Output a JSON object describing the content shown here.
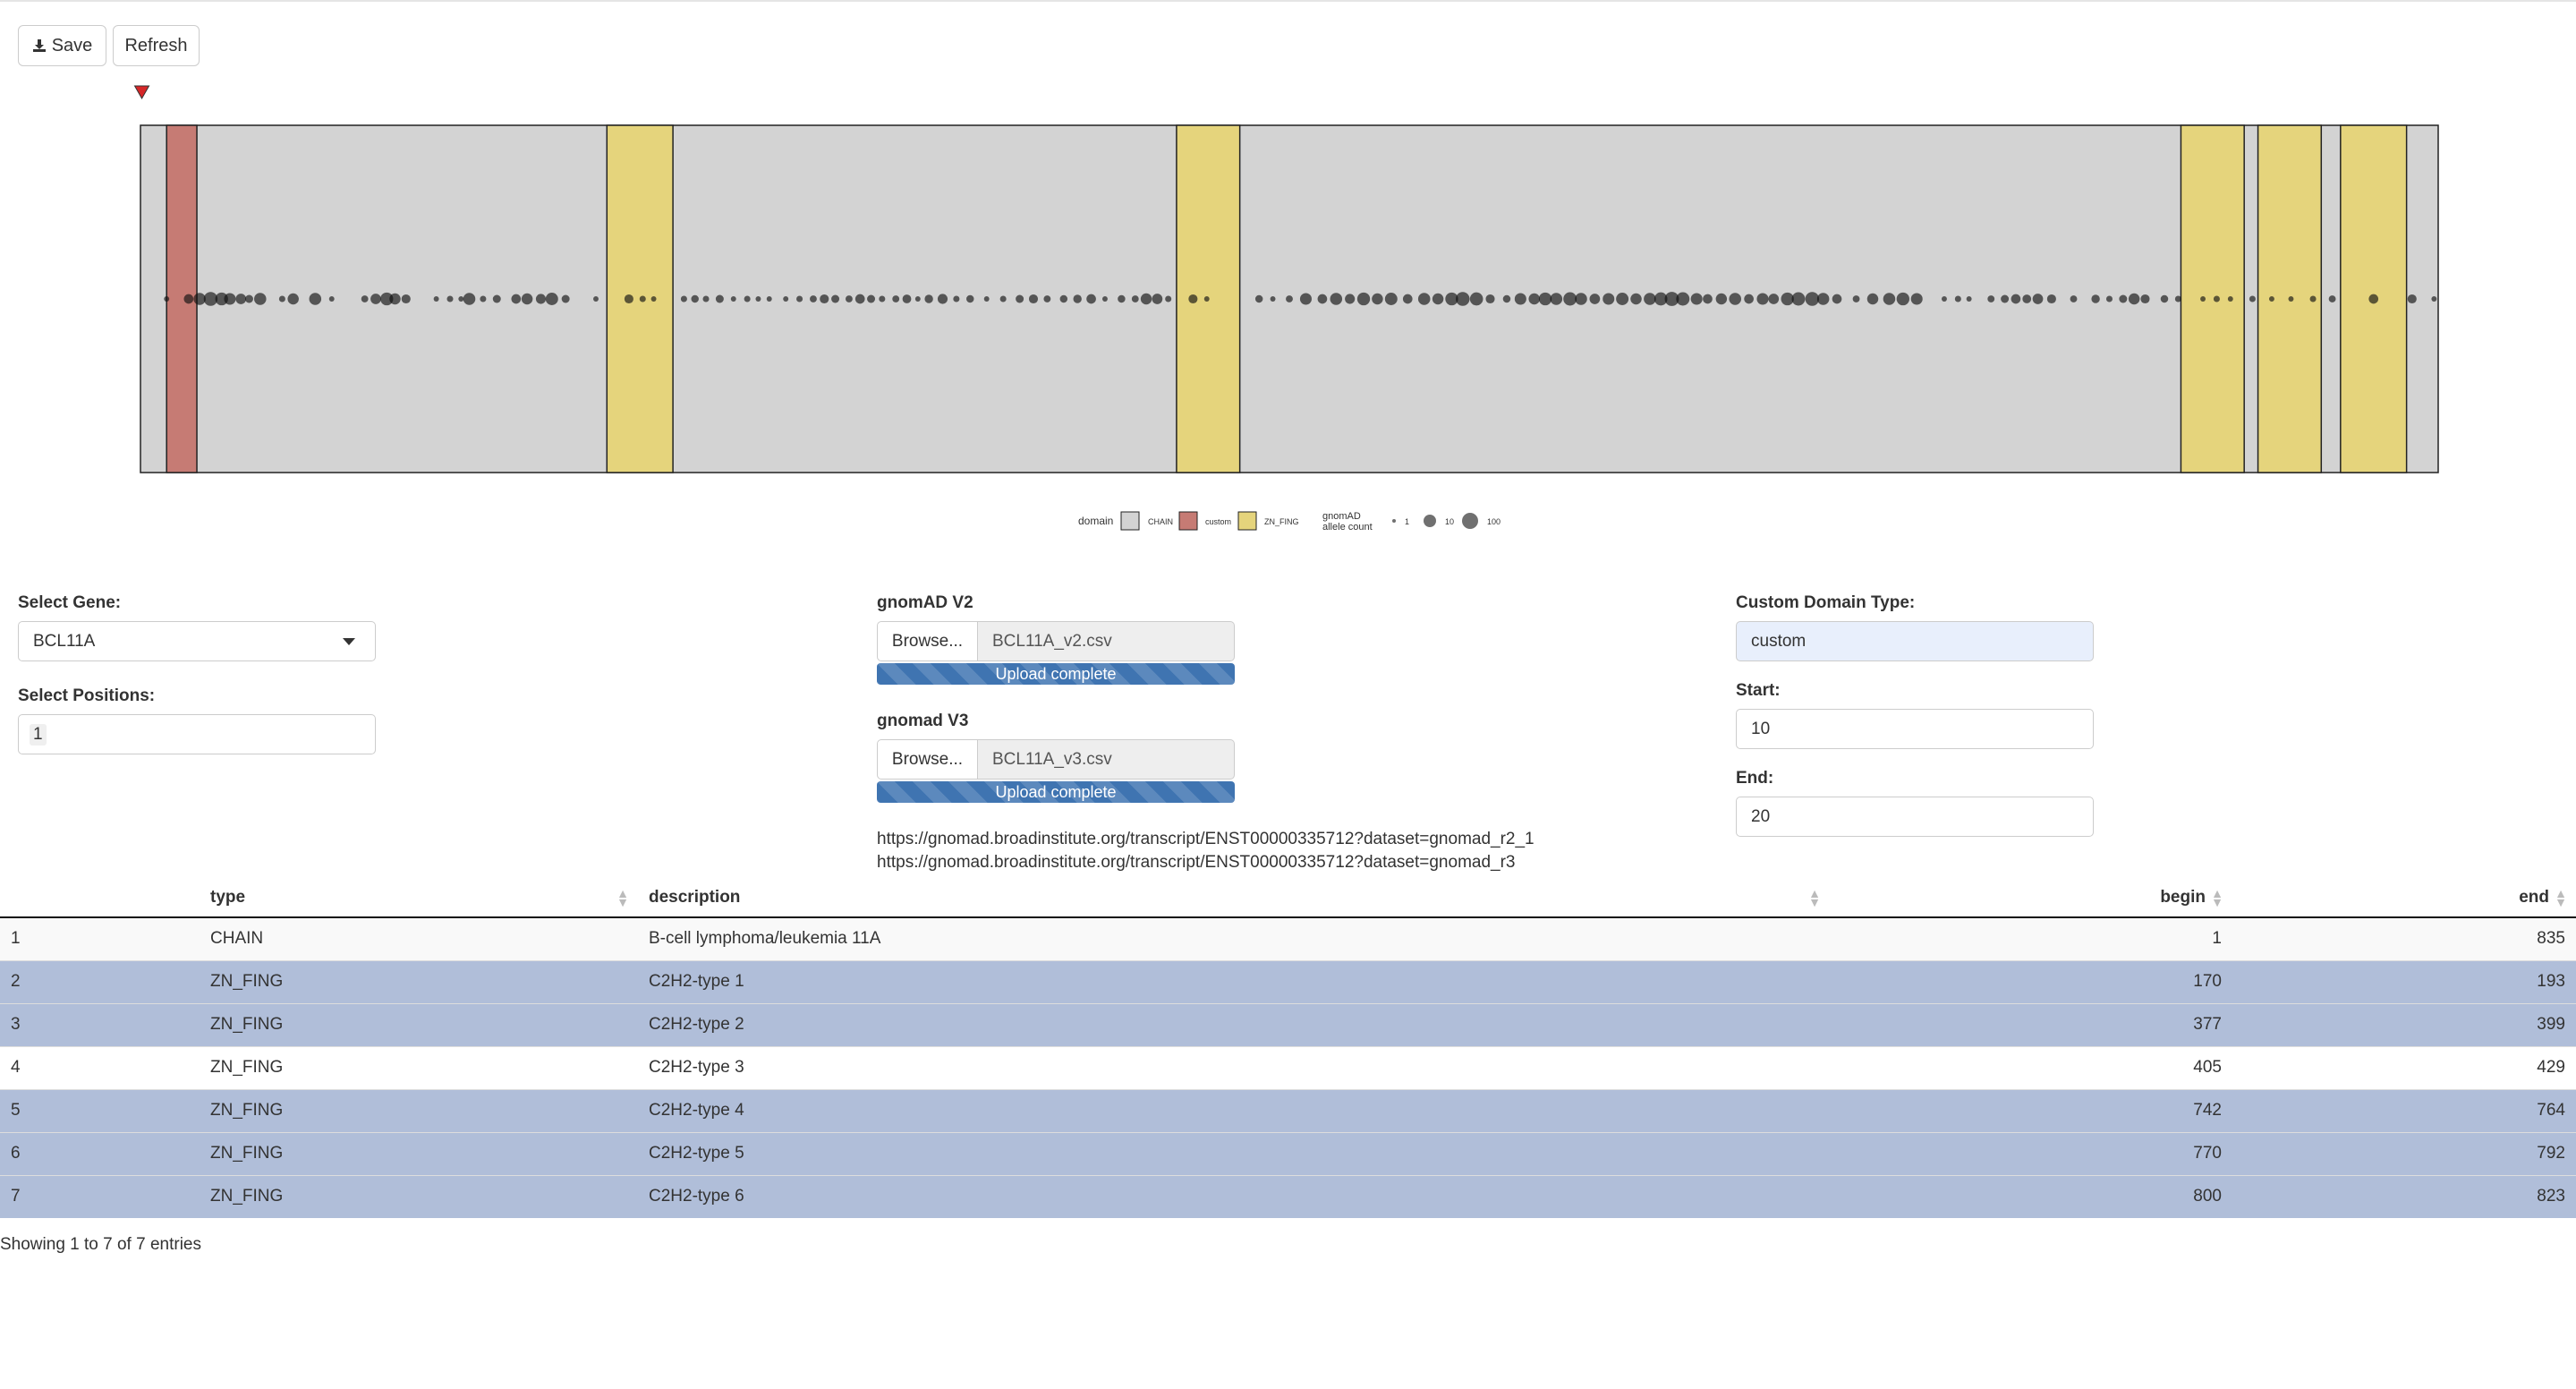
{
  "toolbar": {
    "save_label": "Save",
    "refresh_label": "Refresh"
  },
  "plot": {
    "protein_length": 835,
    "domains": [
      {
        "type": "CHAIN",
        "begin": 1,
        "end": 835,
        "color": "#d3d3d3"
      },
      {
        "type": "custom",
        "begin": 10,
        "end": 20,
        "color": "#c67b74"
      },
      {
        "type": "ZN_FING",
        "begin": 170,
        "end": 193,
        "color": "#e5d47c"
      },
      {
        "type": "ZN_FING",
        "begin": 377,
        "end": 399,
        "color": "#e5d47c"
      },
      {
        "type": "ZN_FING",
        "begin": 742,
        "end": 764,
        "color": "#e5d47c"
      },
      {
        "type": "ZN_FING",
        "begin": 770,
        "end": 792,
        "color": "#e5d47c"
      },
      {
        "type": "ZN_FING",
        "begin": 800,
        "end": 823,
        "color": "#e5d47c"
      }
    ],
    "selected_position": 1,
    "marker_color": "#d62728",
    "variant_allele_counts": [
      {
        "pos": 10,
        "count": 1
      },
      {
        "pos": 18,
        "count": 10
      },
      {
        "pos": 22,
        "count": 30
      },
      {
        "pos": 26,
        "count": 60
      },
      {
        "pos": 30,
        "count": 40
      },
      {
        "pos": 33,
        "count": 25
      },
      {
        "pos": 37,
        "count": 15
      },
      {
        "pos": 40,
        "count": 5
      },
      {
        "pos": 44,
        "count": 30
      },
      {
        "pos": 52,
        "count": 2
      },
      {
        "pos": 56,
        "count": 20
      },
      {
        "pos": 64,
        "count": 30
      },
      {
        "pos": 70,
        "count": 1
      },
      {
        "pos": 82,
        "count": 3
      },
      {
        "pos": 86,
        "count": 15
      },
      {
        "pos": 90,
        "count": 40
      },
      {
        "pos": 93,
        "count": 20
      },
      {
        "pos": 97,
        "count": 8
      },
      {
        "pos": 108,
        "count": 1
      },
      {
        "pos": 113,
        "count": 2
      },
      {
        "pos": 117,
        "count": 1
      },
      {
        "pos": 120,
        "count": 30
      },
      {
        "pos": 125,
        "count": 2
      },
      {
        "pos": 130,
        "count": 5
      },
      {
        "pos": 137,
        "count": 10
      },
      {
        "pos": 141,
        "count": 20
      },
      {
        "pos": 146,
        "count": 12
      },
      {
        "pos": 150,
        "count": 35
      },
      {
        "pos": 155,
        "count": 5
      },
      {
        "pos": 166,
        "count": 1
      },
      {
        "pos": 178,
        "count": 8
      },
      {
        "pos": 183,
        "count": 2
      },
      {
        "pos": 187,
        "count": 1
      },
      {
        "pos": 198,
        "count": 2
      },
      {
        "pos": 202,
        "count": 4
      },
      {
        "pos": 206,
        "count": 2
      },
      {
        "pos": 211,
        "count": 5
      },
      {
        "pos": 216,
        "count": 1
      },
      {
        "pos": 221,
        "count": 2
      },
      {
        "pos": 225,
        "count": 1
      },
      {
        "pos": 229,
        "count": 1
      },
      {
        "pos": 235,
        "count": 1
      },
      {
        "pos": 240,
        "count": 2
      },
      {
        "pos": 245,
        "count": 3
      },
      {
        "pos": 249,
        "count": 8
      },
      {
        "pos": 253,
        "count": 5
      },
      {
        "pos": 258,
        "count": 3
      },
      {
        "pos": 262,
        "count": 10
      },
      {
        "pos": 266,
        "count": 5
      },
      {
        "pos": 270,
        "count": 2
      },
      {
        "pos": 275,
        "count": 3
      },
      {
        "pos": 279,
        "count": 7
      },
      {
        "pos": 283,
        "count": 1
      },
      {
        "pos": 287,
        "count": 6
      },
      {
        "pos": 292,
        "count": 12
      },
      {
        "pos": 297,
        "count": 2
      },
      {
        "pos": 302,
        "count": 4
      },
      {
        "pos": 308,
        "count": 1
      },
      {
        "pos": 314,
        "count": 2
      },
      {
        "pos": 320,
        "count": 5
      },
      {
        "pos": 325,
        "count": 8
      },
      {
        "pos": 330,
        "count": 3
      },
      {
        "pos": 336,
        "count": 4
      },
      {
        "pos": 341,
        "count": 6
      },
      {
        "pos": 346,
        "count": 10
      },
      {
        "pos": 351,
        "count": 1
      },
      {
        "pos": 357,
        "count": 4
      },
      {
        "pos": 362,
        "count": 3
      },
      {
        "pos": 366,
        "count": 20
      },
      {
        "pos": 370,
        "count": 15
      },
      {
        "pos": 374,
        "count": 2
      },
      {
        "pos": 383,
        "count": 8
      },
      {
        "pos": 388,
        "count": 1
      },
      {
        "pos": 407,
        "count": 4
      },
      {
        "pos": 412,
        "count": 1
      },
      {
        "pos": 418,
        "count": 3
      },
      {
        "pos": 424,
        "count": 25
      },
      {
        "pos": 430,
        "count": 10
      },
      {
        "pos": 435,
        "count": 30
      },
      {
        "pos": 440,
        "count": 12
      },
      {
        "pos": 445,
        "count": 40
      },
      {
        "pos": 450,
        "count": 20
      },
      {
        "pos": 455,
        "count": 35
      },
      {
        "pos": 461,
        "count": 10
      },
      {
        "pos": 467,
        "count": 30
      },
      {
        "pos": 472,
        "count": 20
      },
      {
        "pos": 477,
        "count": 40
      },
      {
        "pos": 481,
        "count": 60
      },
      {
        "pos": 486,
        "count": 45
      },
      {
        "pos": 491,
        "count": 8
      },
      {
        "pos": 497,
        "count": 4
      },
      {
        "pos": 502,
        "count": 25
      },
      {
        "pos": 507,
        "count": 20
      },
      {
        "pos": 511,
        "count": 40
      },
      {
        "pos": 515,
        "count": 30
      },
      {
        "pos": 520,
        "count": 50
      },
      {
        "pos": 524,
        "count": 30
      },
      {
        "pos": 529,
        "count": 15
      },
      {
        "pos": 534,
        "count": 25
      },
      {
        "pos": 539,
        "count": 35
      },
      {
        "pos": 544,
        "count": 20
      },
      {
        "pos": 549,
        "count": 30
      },
      {
        "pos": 553,
        "count": 45
      },
      {
        "pos": 557,
        "count": 70
      },
      {
        "pos": 561,
        "count": 50
      },
      {
        "pos": 566,
        "count": 25
      },
      {
        "pos": 570,
        "count": 10
      },
      {
        "pos": 575,
        "count": 20
      },
      {
        "pos": 580,
        "count": 30
      },
      {
        "pos": 585,
        "count": 10
      },
      {
        "pos": 590,
        "count": 25
      },
      {
        "pos": 594,
        "count": 15
      },
      {
        "pos": 599,
        "count": 40
      },
      {
        "pos": 603,
        "count": 50
      },
      {
        "pos": 608,
        "count": 60
      },
      {
        "pos": 612,
        "count": 30
      },
      {
        "pos": 617,
        "count": 10
      },
      {
        "pos": 624,
        "count": 3
      },
      {
        "pos": 630,
        "count": 20
      },
      {
        "pos": 636,
        "count": 30
      },
      {
        "pos": 641,
        "count": 40
      },
      {
        "pos": 646,
        "count": 25
      },
      {
        "pos": 656,
        "count": 1
      },
      {
        "pos": 661,
        "count": 2
      },
      {
        "pos": 665,
        "count": 1
      },
      {
        "pos": 673,
        "count": 3
      },
      {
        "pos": 678,
        "count": 5
      },
      {
        "pos": 682,
        "count": 10
      },
      {
        "pos": 686,
        "count": 7
      },
      {
        "pos": 690,
        "count": 15
      },
      {
        "pos": 695,
        "count": 8
      },
      {
        "pos": 703,
        "count": 3
      },
      {
        "pos": 711,
        "count": 6
      },
      {
        "pos": 716,
        "count": 2
      },
      {
        "pos": 721,
        "count": 5
      },
      {
        "pos": 725,
        "count": 20
      },
      {
        "pos": 729,
        "count": 8
      },
      {
        "pos": 736,
        "count": 4
      },
      {
        "pos": 741,
        "count": 2
      },
      {
        "pos": 750,
        "count": 1
      },
      {
        "pos": 755,
        "count": 2
      },
      {
        "pos": 760,
        "count": 1
      },
      {
        "pos": 768,
        "count": 2
      },
      {
        "pos": 775,
        "count": 1
      },
      {
        "pos": 782,
        "count": 1
      },
      {
        "pos": 790,
        "count": 2
      },
      {
        "pos": 797,
        "count": 3
      },
      {
        "pos": 812,
        "count": 10
      },
      {
        "pos": 826,
        "count": 8
      },
      {
        "pos": 834,
        "count": 1
      }
    ]
  },
  "legend": {
    "domain_title": "domain",
    "items": [
      {
        "label": "CHAIN",
        "color": "#d3d3d3"
      },
      {
        "label": "custom",
        "color": "#c67b74"
      },
      {
        "label": "ZN_FING",
        "color": "#e5d47c"
      }
    ],
    "count_title_line1": "gnomAD",
    "count_title_line2": "allele count",
    "count_items": [
      "1",
      "10",
      "100"
    ]
  },
  "controls": {
    "gene_label": "Select Gene:",
    "gene_value": "BCL11A",
    "positions_label": "Select Positions:",
    "positions_value": "1",
    "gnomad_v2_label": "gnomAD V2",
    "gnomad_v2_browse": "Browse...",
    "gnomad_v2_file": "BCL11A_v2.csv",
    "gnomad_v2_status": "Upload complete",
    "gnomad_v3_label": "gnomad V3",
    "gnomad_v3_browse": "Browse...",
    "gnomad_v3_file": "BCL11A_v3.csv",
    "gnomad_v3_status": "Upload complete",
    "link_v2": "https://gnomad.broadinstitute.org/transcript/ENST00000335712?dataset=gnomad_r2_1",
    "link_v3": "https://gnomad.broadinstitute.org/transcript/ENST00000335712?dataset=gnomad_r3",
    "custom_type_label": "Custom Domain Type:",
    "custom_type_value": "custom",
    "start_label": "Start:",
    "start_value": "10",
    "end_label": "End:",
    "end_value": "20"
  },
  "table": {
    "headers": [
      "",
      "type",
      "description",
      "begin",
      "end"
    ],
    "rows": [
      [
        "1",
        "CHAIN",
        "B-cell lymphoma/leukemia 11A",
        "1",
        "835"
      ],
      [
        "2",
        "ZN_FING",
        "C2H2-type 1",
        "170",
        "193"
      ],
      [
        "3",
        "ZN_FING",
        "C2H2-type 2",
        "377",
        "399"
      ],
      [
        "4",
        "ZN_FING",
        "C2H2-type 3",
        "405",
        "429"
      ],
      [
        "5",
        "ZN_FING",
        "C2H2-type 4",
        "742",
        "764"
      ],
      [
        "6",
        "ZN_FING",
        "C2H2-type 5",
        "770",
        "792"
      ],
      [
        "7",
        "ZN_FING",
        "C2H2-type 6",
        "800",
        "823"
      ]
    ],
    "selected_rows": [
      2,
      3,
      5,
      6,
      7
    ],
    "info": "Showing 1 to 7 of 7 entries"
  }
}
